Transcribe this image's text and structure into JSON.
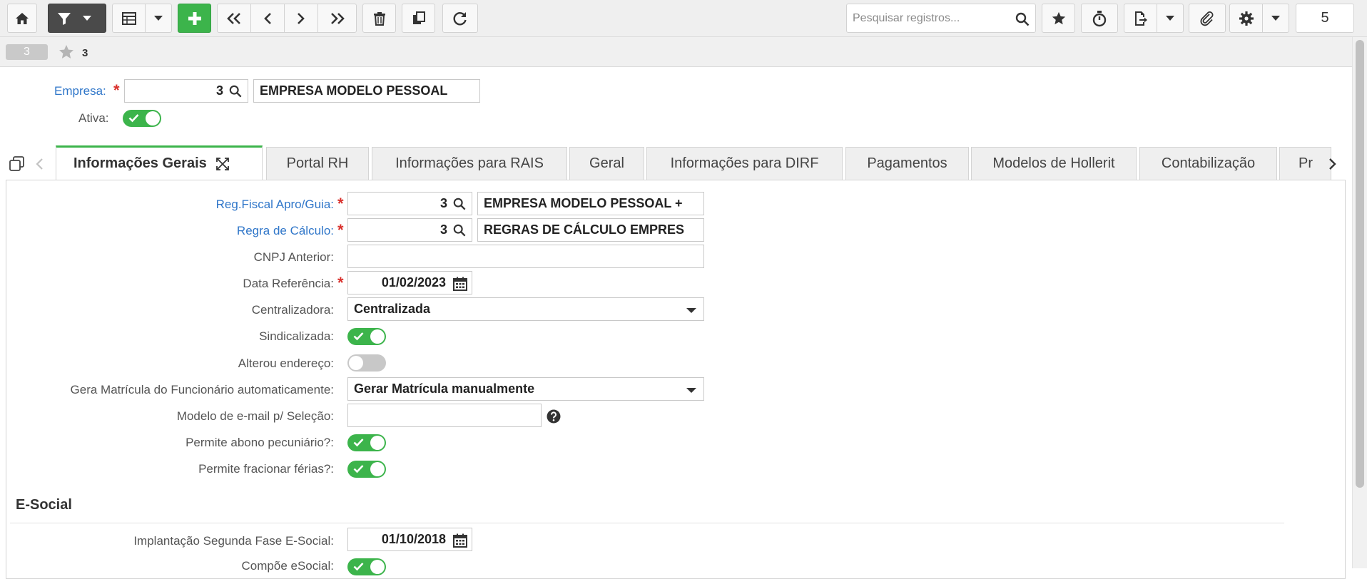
{
  "toolbar": {
    "search_placeholder": "Pesquisar registros...",
    "record_count": "5",
    "buttons": [
      "home-icon",
      "filter-icon",
      "grid-icon",
      "add-icon",
      "first-icon",
      "prev-icon",
      "next-icon",
      "last-icon",
      "trash-icon",
      "copy-icon",
      "refresh-icon",
      "star-icon",
      "stopwatch-icon",
      "export-icon",
      "paperclip-icon",
      "gear-icon"
    ]
  },
  "record": {
    "id": "3",
    "favorite_label": "3"
  },
  "header": {
    "empresa_label": "Empresa:",
    "empresa_code": "3",
    "empresa_name": "EMPRESA MODELO PESSOAL",
    "ativa_label": "Ativa:",
    "ativa": true
  },
  "tabs": [
    {
      "label": "Informações Gerais",
      "active": true
    },
    {
      "label": "Portal RH"
    },
    {
      "label": "Informações para RAIS"
    },
    {
      "label": "Geral"
    },
    {
      "label": "Informações para DIRF"
    },
    {
      "label": "Pagamentos"
    },
    {
      "label": "Modelos de Hollerit"
    },
    {
      "label": "Contabilização"
    },
    {
      "label": "Pr"
    }
  ],
  "form": {
    "reg_fiscal_label": "Reg.Fiscal Apro/Guia:",
    "reg_fiscal_code": "3",
    "reg_fiscal_name": "EMPRESA MODELO PESSOAL +",
    "regra_label": "Regra de Cálculo:",
    "regra_code": "3",
    "regra_name": "REGRAS DE CÁLCULO EMPRES",
    "cnpj_label": "CNPJ Anterior:",
    "cnpj_value": "",
    "data_ref_label": "Data Referência:",
    "data_ref_value": "01/02/2023",
    "centralizadora_label": "Centralizadora:",
    "centralizadora_value": "Centralizada",
    "sindicalizada_label": "Sindicalizada:",
    "sindicalizada": true,
    "alterou_label": "Alterou endereço:",
    "alterou": false,
    "gera_matricula_label": "Gera Matrícula do Funcionário automaticamente:",
    "gera_matricula_value": "Gerar Matrícula manualmente",
    "modelo_email_label": "Modelo de e-mail p/ Seleção:",
    "modelo_email_value": "",
    "abono_label": "Permite abono pecuniário?:",
    "abono": true,
    "fracionar_label": "Permite fracionar férias?:",
    "fracionar": true
  },
  "esocial": {
    "title": "E-Social",
    "implantacao_label": "Implantação Segunda Fase E-Social:",
    "implantacao_value": "01/10/2018",
    "compoe_label": "Compõe eSocial:",
    "compoe": true
  },
  "colors": {
    "accent_green": "#3cb44b",
    "link_blue": "#2f76c9",
    "required_red": "#d9302c"
  }
}
